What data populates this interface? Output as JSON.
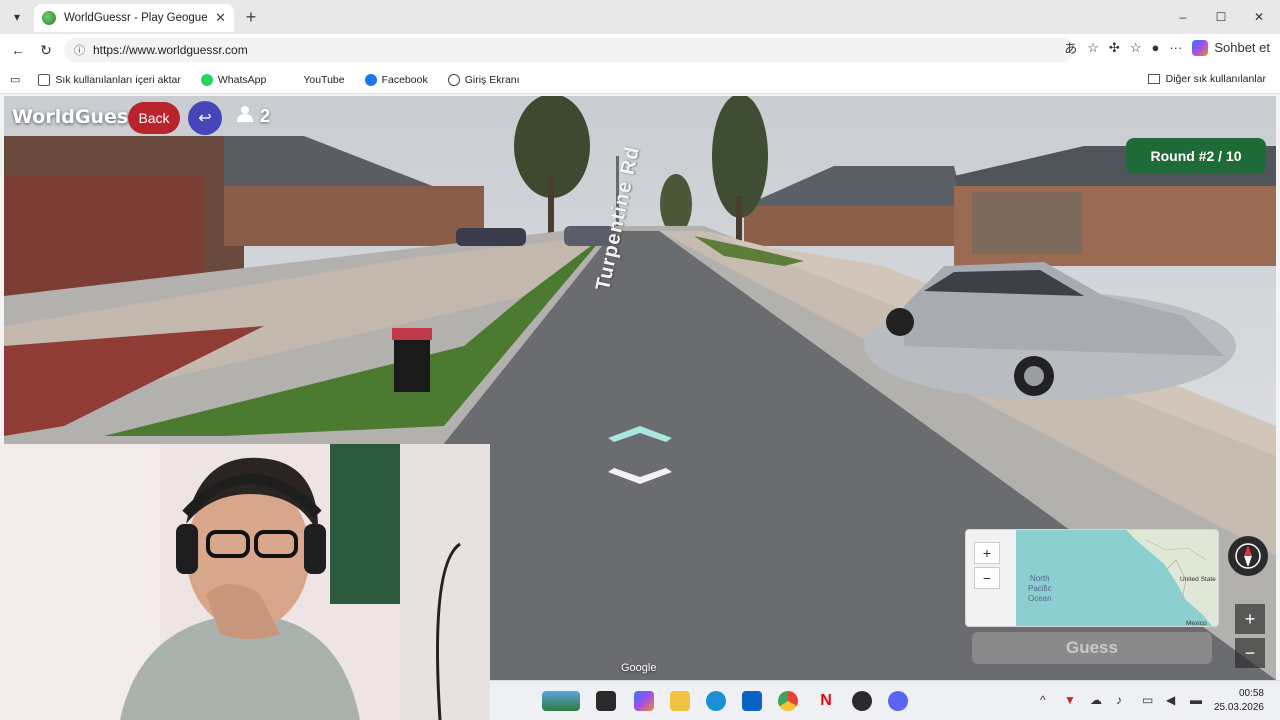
{
  "browser": {
    "tab_title": "WorldGuessr - Play Geoguessr for",
    "tab_close": "✕",
    "new_tab": "+",
    "url": "https://www.worldguessr.com",
    "copilot_label": "Sohbet et",
    "window_controls": {
      "minimize": "–",
      "maximize": "☐",
      "close": "✕"
    }
  },
  "favorites": {
    "items": [
      {
        "label": "Sık kullanılanları içeri aktar",
        "icon": "import-icon"
      },
      {
        "label": "WhatsApp",
        "icon": "whatsapp-icon"
      },
      {
        "label": "YouTube",
        "icon": "youtube-icon"
      },
      {
        "label": "Facebook",
        "icon": "facebook-icon"
      },
      {
        "label": "Giriş Ekranı",
        "icon": "globe-icon"
      }
    ],
    "other_label": "Diğer sık kullanılanlar"
  },
  "game": {
    "logo": "WorldGuessr",
    "back_label": "Back",
    "return_icon": "↩",
    "player_count": "2",
    "round": "Round #2 / 10",
    "street_sign": "Turpentine Rd",
    "guess_label": "Guess",
    "google_mark": "Google",
    "minimap": {
      "zoom_in": "+",
      "zoom_out": "−",
      "ocean_label": "North\nPacific\nOcean",
      "ocean_line1": "North",
      "ocean_line2": "Pacific",
      "ocean_line3": "Ocean",
      "land_label_1": "United State",
      "land_label_2": "Mexico"
    },
    "sv_zoom_in": "+",
    "sv_zoom_out": "−"
  },
  "taskbar": {
    "time": "00:58",
    "date": "25.03.2026"
  },
  "colors": {
    "back_button": "#b8232c",
    "return_button": "#4646b8",
    "round_badge": "#1f6b38",
    "guess_disabled": "#8a8a8a",
    "map_water": "#8ccfd0"
  }
}
